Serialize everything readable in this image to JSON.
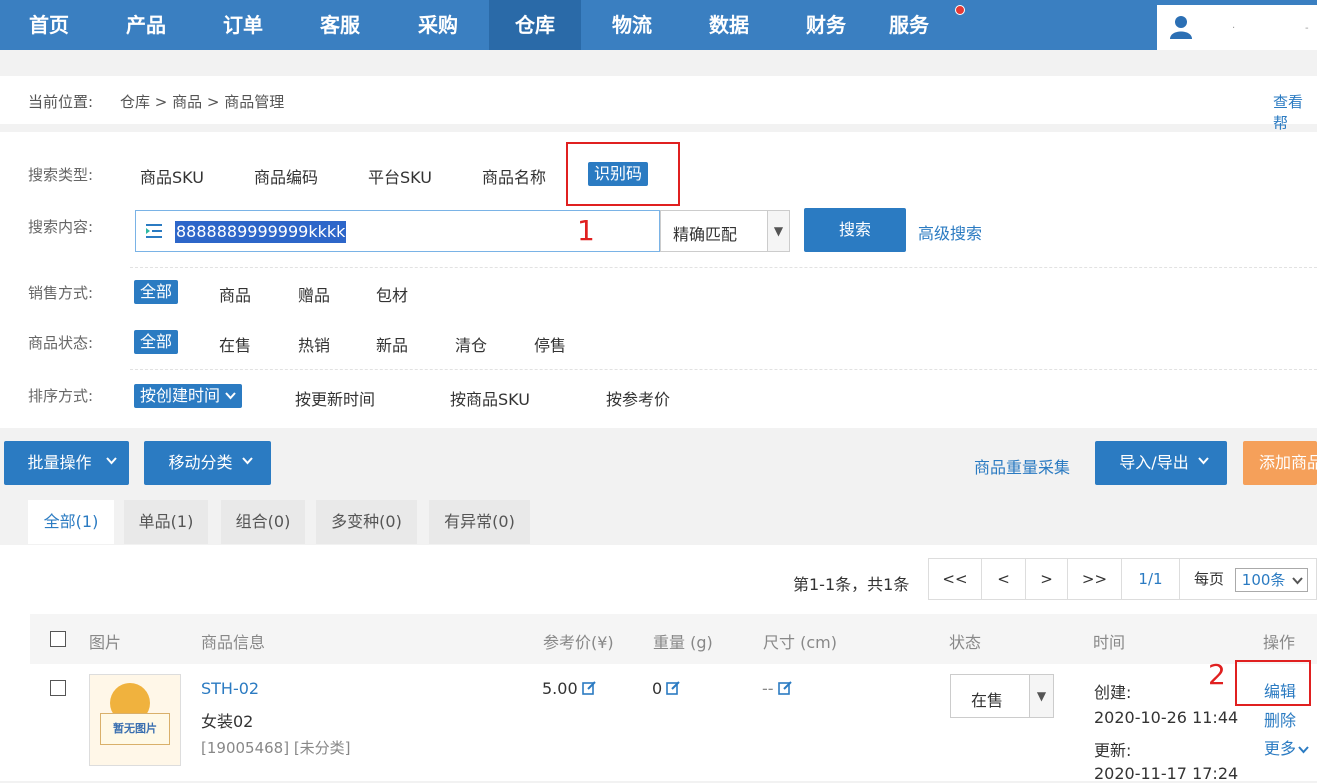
{
  "nav": {
    "items": [
      "首页",
      "产品",
      "订单",
      "客服",
      "采购",
      "仓库",
      "物流",
      "数据",
      "财务",
      "服务"
    ],
    "active": "仓库"
  },
  "user": {
    "dots": "·",
    "dots2": "-"
  },
  "breadcrumb": {
    "label": "当前位置:",
    "path": "仓库 > 商品 > 商品管理",
    "help": "查看帮"
  },
  "search": {
    "type_label": "搜索类型:",
    "types": [
      "商品SKU",
      "商品编码",
      "平台SKU",
      "商品名称",
      "识别码"
    ],
    "content_label": "搜索内容:",
    "input_value": "8888889999999kkkk",
    "match_mode": "精确匹配",
    "search_button": "搜索",
    "advanced_link": "高级搜索",
    "annotation_1": "1",
    "sale_label": "销售方式:",
    "sale_options": [
      "全部",
      "商品",
      "赠品",
      "包材"
    ],
    "status_label": "商品状态:",
    "status_options": [
      "全部",
      "在售",
      "热销",
      "新品",
      "清仓",
      "停售"
    ],
    "sort_label": "排序方式:",
    "sort_options": [
      "按创建时间",
      "按更新时间",
      "按商品SKU",
      "按参考价"
    ]
  },
  "toolbar": {
    "batch": "批量操作",
    "move": "移动分类",
    "weight_collect": "商品重量采集",
    "import_export": "导入/导出",
    "add_product": "添加商品"
  },
  "tabs": [
    "全部(1)",
    "单品(1)",
    "组合(0)",
    "多变种(0)",
    "有异常(0)"
  ],
  "pager": {
    "summary": "第1-1条，共1条",
    "first": "<<",
    "prev": "<",
    "next": ">",
    "last": ">>",
    "page": "1/1",
    "per_page_label": "每页",
    "per_page_value": "100条"
  },
  "table": {
    "headers": {
      "image": "图片",
      "info": "商品信息",
      "price": "参考价(¥)",
      "weight": "重量 (g)",
      "size": "尺寸 (cm)",
      "status": "状态",
      "time": "时间",
      "actions": "操作"
    },
    "row": {
      "no_image": "暂无图片",
      "sku": "STH-02",
      "name": "女装02",
      "meta": "[19005468] [未分类]",
      "price": "5.00",
      "weight": "0",
      "size": "--",
      "status": "在售",
      "created_label": "创建:",
      "created": "2020-10-26 11:44",
      "updated_label": "更新:",
      "updated": "2020-11-17 17:24",
      "edit": "编辑",
      "delete": "删除",
      "more": "更多",
      "annotation_2": "2"
    }
  },
  "colors": {
    "nav_bg": "#3a7fc1",
    "accent": "#2b7bc2",
    "orange": "#f5a05a",
    "highlight_box": "#e02020"
  }
}
